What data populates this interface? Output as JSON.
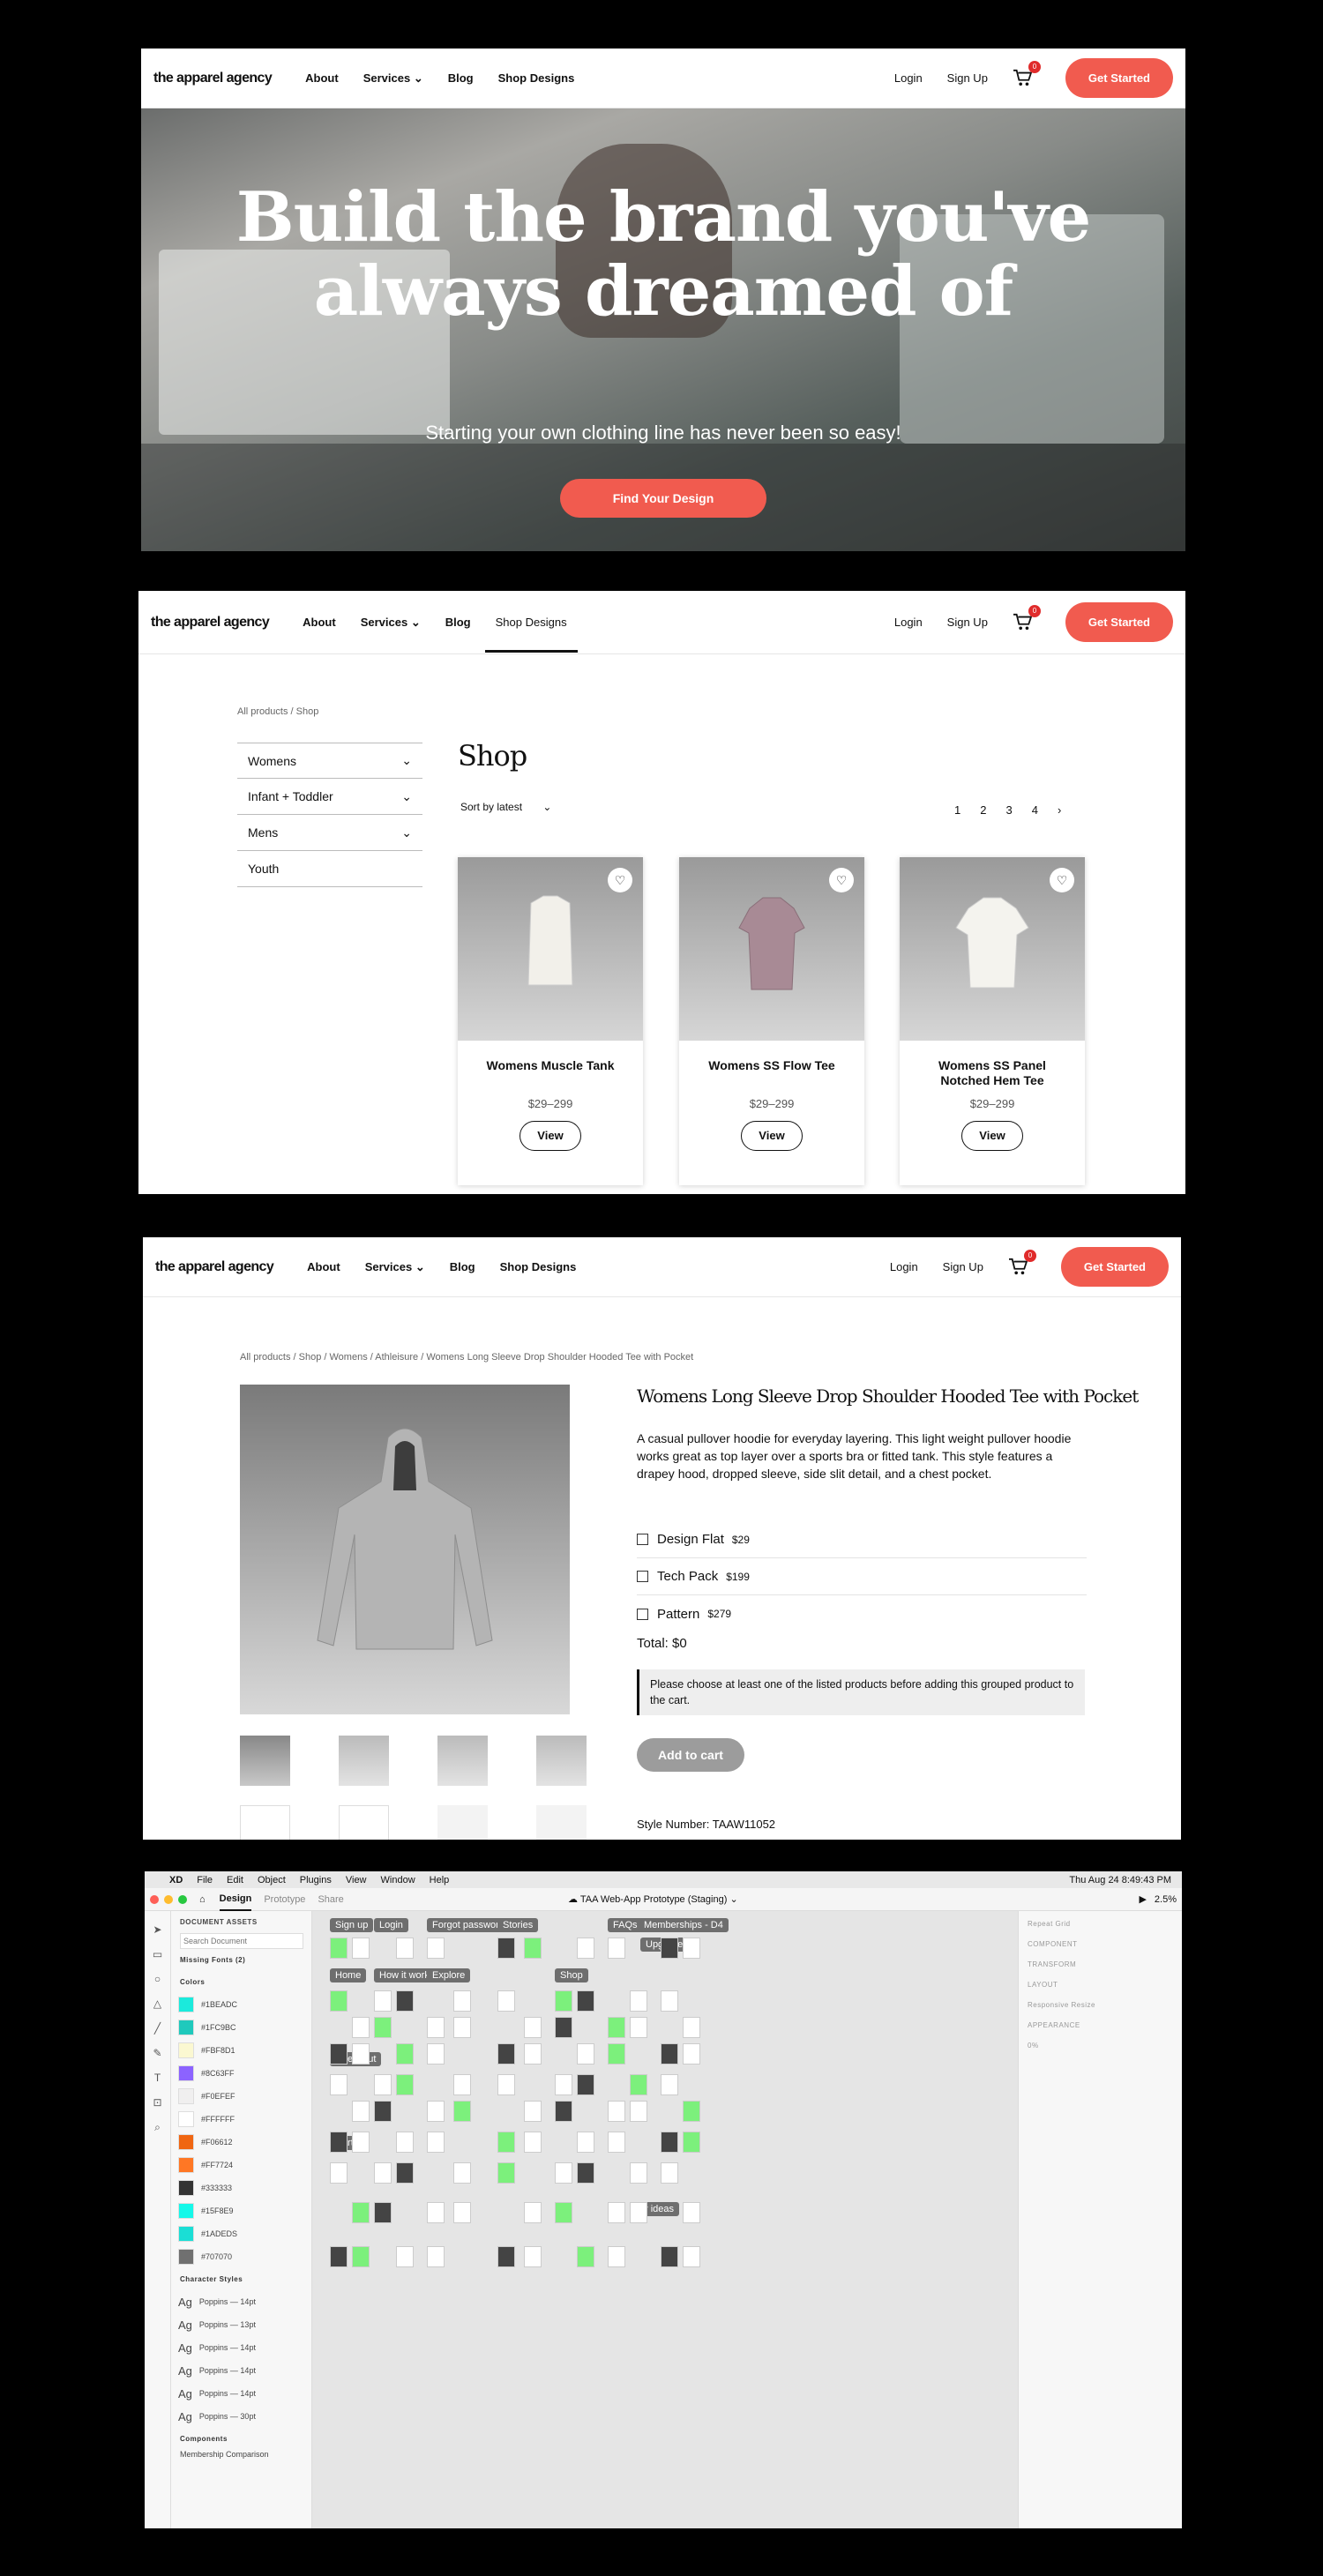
{
  "nav": {
    "logo": "the apparel agency",
    "about": "About",
    "services": "Services",
    "blog": "Blog",
    "shop_designs": "Shop Designs",
    "login": "Login",
    "signup": "Sign Up",
    "cart_count": "0",
    "get_started": "Get Started"
  },
  "hero": {
    "headline": "Build the brand you've always dreamed of",
    "subtext": "Starting your own clothing line has never been so easy!",
    "button": "Find Your Design"
  },
  "shop": {
    "breadcrumb": "All products / Shop",
    "title": "Shop",
    "sort": "Sort by latest",
    "categories": [
      "Womens",
      "Infant + Toddler",
      "Mens",
      "Youth"
    ],
    "pages": [
      "1",
      "2",
      "3",
      "4",
      "›"
    ],
    "products": [
      {
        "name": "Womens Muscle Tank",
        "price": "$29–299",
        "view": "View"
      },
      {
        "name": "Womens SS Flow Tee",
        "price": "$29–299",
        "view": "View"
      },
      {
        "name": "Womens SS Panel Notched Hem Tee",
        "price": "$29–299",
        "view": "View"
      }
    ]
  },
  "product": {
    "breadcrumb": "All products / Shop / Womens / Athleisure / Womens Long Sleeve Drop Shoulder Hooded Tee with Pocket",
    "title": "Womens Long Sleeve Drop Shoulder Hooded Tee with Pocket",
    "description": "A casual pullover hoodie for everyday layering. This light weight pullover hoodie works great as top layer over a sports bra or fitted tank. This style features a drapey hood, dropped sleeve, side slit detail, and a chest pocket.",
    "options": [
      {
        "label": "Design Flat",
        "price": "$29"
      },
      {
        "label": "Tech Pack",
        "price": "$199"
      },
      {
        "label": "Pattern",
        "price": "$279"
      }
    ],
    "total": "Total: $0",
    "notice": "Please choose at least one of the listed products before adding this grouped product to the cart.",
    "add_to_cart": "Add to cart",
    "style_number": "Style Number: TAAW11052"
  },
  "xd": {
    "menu": [
      "XD",
      "File",
      "Edit",
      "Object",
      "Plugins",
      "View",
      "Window",
      "Help"
    ],
    "clock": "Thu Aug 24  8:49:43 PM",
    "tabs": [
      "Design",
      "Prototype",
      "Share"
    ],
    "doc_title": "TAA Web-App Prototype (Staging)",
    "zoom": "2.5%",
    "assets_header": "DOCUMENT ASSETS",
    "search_placeholder": "Search Document",
    "missing_fonts": "Missing Fonts (2)",
    "colors_header": "Colors",
    "colors": [
      "#1BEADC",
      "#1FC9BC",
      "#FBF8D1",
      "#8C63FF",
      "#F0EFEF",
      "#FFFFFF",
      "#F06612",
      "#FF7724",
      "#333333",
      "#15F8E9",
      "#1ADEDS",
      "#707070"
    ],
    "char_header": "Character Styles",
    "char_styles": [
      "Poppins — 14pt",
      "Poppins — 13pt",
      "Poppins — 14pt",
      "Poppins — 14pt",
      "Poppins — 14pt",
      "Poppins — 30pt"
    ],
    "components_header": "Components",
    "component_first": "Membership Comparison",
    "artboard_labels": [
      "Sign up",
      "Login",
      "Forgot password",
      "Stories",
      "FAQs",
      "Memberships - D4",
      "Upgrade",
      "Home",
      "How it works",
      "Explore",
      "Shop",
      "Checkout",
      "Cart",
      "My ideas"
    ],
    "props": [
      "Repeat Grid",
      "COMPONENT",
      "TRANSFORM",
      "LAYOUT",
      "Responsive Resize",
      "APPEARANCE",
      "0%"
    ]
  }
}
